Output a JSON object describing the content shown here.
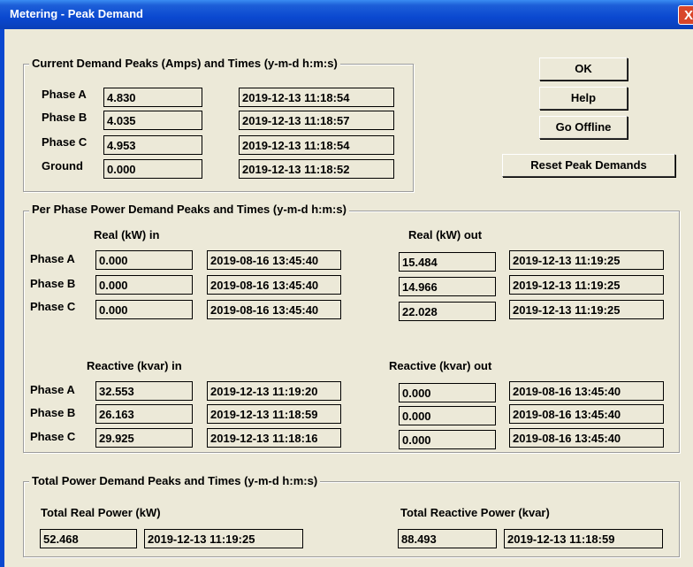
{
  "window": {
    "title": "Metering - Peak Demand",
    "close_label": "X"
  },
  "buttons": {
    "ok": "OK",
    "help": "Help",
    "go_offline": "Go Offline",
    "reset": "Reset Peak Demands"
  },
  "current": {
    "legend": "Current Demand Peaks (Amps) and Times (y-m-d  h:m:s)",
    "rows": [
      {
        "label": "Phase A",
        "value": "4.830",
        "time": "2019-12-13 11:18:54"
      },
      {
        "label": "Phase B",
        "value": "4.035",
        "time": "2019-12-13 11:18:57"
      },
      {
        "label": "Phase C",
        "value": "4.953",
        "time": "2019-12-13 11:18:54"
      },
      {
        "label": "Ground",
        "value": "0.000",
        "time": "2019-12-13 11:18:52"
      }
    ]
  },
  "perphase": {
    "legend": "Per Phase Power Demand Peaks and Times (y-m-d  h:m:s)",
    "real_in_header": "Real (kW) in",
    "real_out_header": "Real (kW) out",
    "reactive_in_header": "Reactive (kvar) in",
    "reactive_out_header": "Reactive (kvar) out",
    "labels": [
      "Phase A",
      "Phase B",
      "Phase C"
    ],
    "real_in": [
      {
        "value": "0.000",
        "time": "2019-08-16 13:45:40"
      },
      {
        "value": "0.000",
        "time": "2019-08-16 13:45:40"
      },
      {
        "value": "0.000",
        "time": "2019-08-16 13:45:40"
      }
    ],
    "real_out": [
      {
        "value": "15.484",
        "time": "2019-12-13 11:19:25"
      },
      {
        "value": "14.966",
        "time": "2019-12-13 11:19:25"
      },
      {
        "value": "22.028",
        "time": "2019-12-13 11:19:25"
      }
    ],
    "reactive_in": [
      {
        "value": "32.553",
        "time": "2019-12-13 11:19:20"
      },
      {
        "value": "26.163",
        "time": "2019-12-13 11:18:59"
      },
      {
        "value": "29.925",
        "time": "2019-12-13 11:18:16"
      }
    ],
    "reactive_out": [
      {
        "value": "0.000",
        "time": "2019-08-16 13:45:40"
      },
      {
        "value": "0.000",
        "time": "2019-08-16 13:45:40"
      },
      {
        "value": "0.000",
        "time": "2019-08-16 13:45:40"
      }
    ]
  },
  "total": {
    "legend": "Total Power Demand Peaks and Times (y-m-d  h:m:s)",
    "real_header": "Total Real Power (kW)",
    "real_value": "52.468",
    "real_time": "2019-12-13 11:19:25",
    "reactive_header": "Total Reactive Power (kvar)",
    "reactive_value": "88.493",
    "reactive_time": "2019-12-13 11:18:59"
  }
}
